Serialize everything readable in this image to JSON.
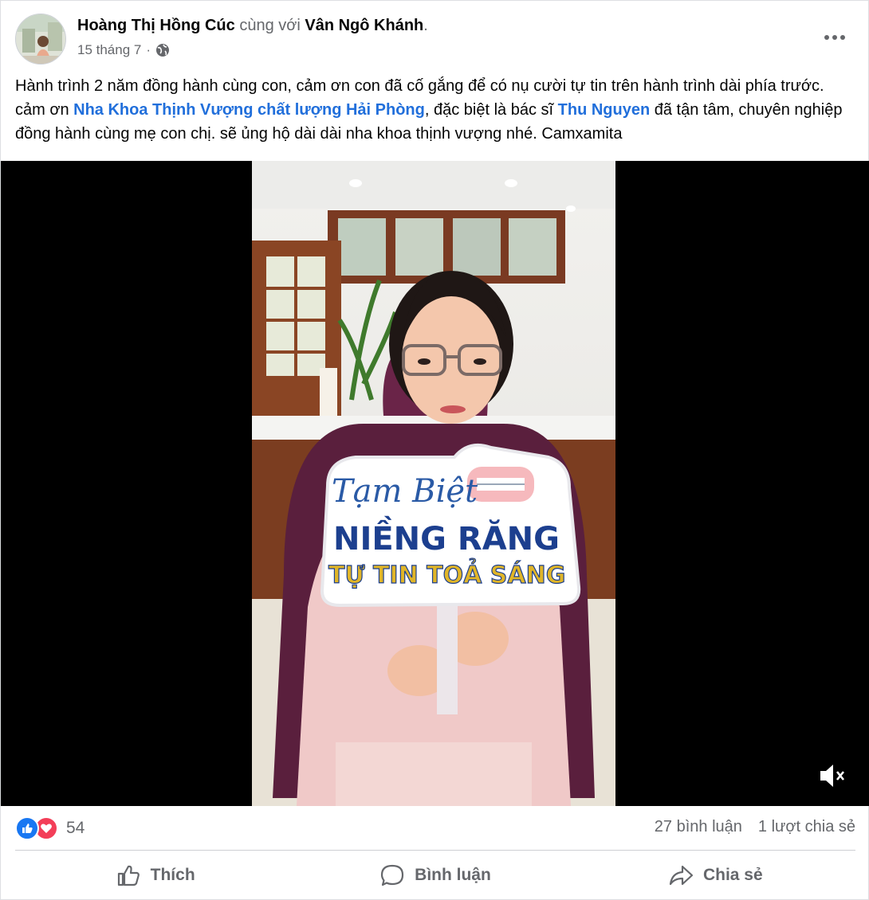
{
  "post": {
    "author": "Hoàng Thị Hồng Cúc",
    "with_text": "cùng với",
    "tagged": "Vân Ngô Khánh",
    "trailing_dot": ".",
    "date": "15 tháng 7",
    "separator": "·",
    "privacy_icon": "globe-icon",
    "text_part1": "Hành trình 2 năm đồng hành cùng con, cảm ơn con đã cố gắng để có nụ cười tự tin trên hành trình dài phía trước. cảm ơn ",
    "link1": "Nha Khoa Thịnh Vượng chất lượng Hải Phòng",
    "text_part2": ", đặc biệt là bác sĩ ",
    "link2": "Thu Nguyen",
    "text_part3": " đã tận tâm, chuyên nghiệp đồng hành cùng mẹ con chị. sẽ ủng hộ dài dài nha khoa thịnh vượng nhé. Camxamita"
  },
  "video": {
    "sign_line1": "Tạm Biệt",
    "sign_line2": "NIỀNG RĂNG",
    "sign_line3": "TỰ TIN TOẢ SÁNG",
    "mute_icon": "speaker-muted-icon"
  },
  "stats": {
    "reaction_count": "54",
    "comments": "27 bình luận",
    "shares": "1 lượt chia sẻ"
  },
  "actions": {
    "like": "Thích",
    "comment": "Bình luận",
    "share": "Chia sẻ"
  },
  "colors": {
    "link": "#216fdb",
    "like_blue": "#1877f2",
    "love_red": "#f33e58",
    "secondary_text": "#65676b"
  }
}
